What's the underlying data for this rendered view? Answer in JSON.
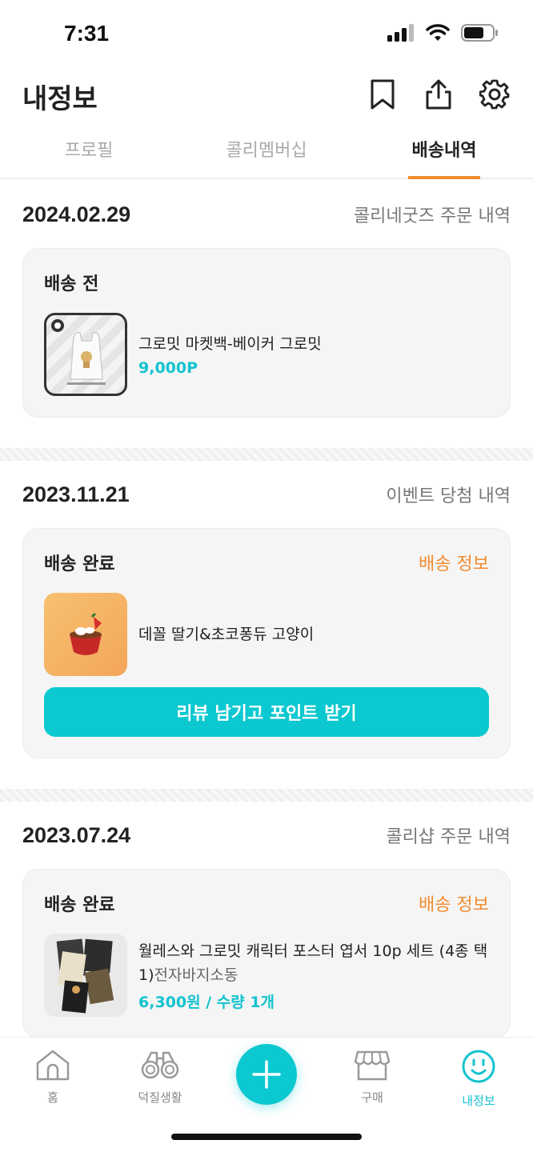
{
  "status_bar": {
    "time": "7:31"
  },
  "header": {
    "title": "내정보"
  },
  "tabs": [
    {
      "label": "프로필",
      "active": false
    },
    {
      "label": "콜리멤버십",
      "active": false
    },
    {
      "label": "배송내역",
      "active": true
    }
  ],
  "orders": [
    {
      "date": "2024.02.29",
      "type": "콜리네굿즈 주문 내역",
      "status": "배송 전",
      "item_name": "그로밋 마켓백-베이커 그로밋",
      "item_price": "9,000P"
    },
    {
      "date": "2023.11.21",
      "type": "이벤트 당첨 내역",
      "status": "배송 완료",
      "link": "배송 정보",
      "item_name": "데꼴 딸기&초코퐁듀 고양이",
      "review_button": "리뷰 남기고 포인트 받기"
    },
    {
      "date": "2023.07.24",
      "type": "콜리샵 주문 내역",
      "status": "배송 완료",
      "link": "배송 정보",
      "item_name": "월레스와 그로밋 캐릭터 포스터 엽서 10p 세트 (4종 택 1)",
      "item_option": "전자바지소동",
      "item_price": "6,300원 / 수량 1개"
    }
  ],
  "bottom_nav": [
    {
      "label": "홈",
      "icon": "home-icon"
    },
    {
      "label": "덕질생활",
      "icon": "binoculars-icon"
    },
    {
      "label": "구매",
      "icon": "shop-icon"
    },
    {
      "label": "내정보",
      "icon": "smile-icon",
      "active": true
    }
  ],
  "colors": {
    "accent": "#0cc8d0",
    "orange": "#f28c30",
    "price": "#12c3cf"
  }
}
